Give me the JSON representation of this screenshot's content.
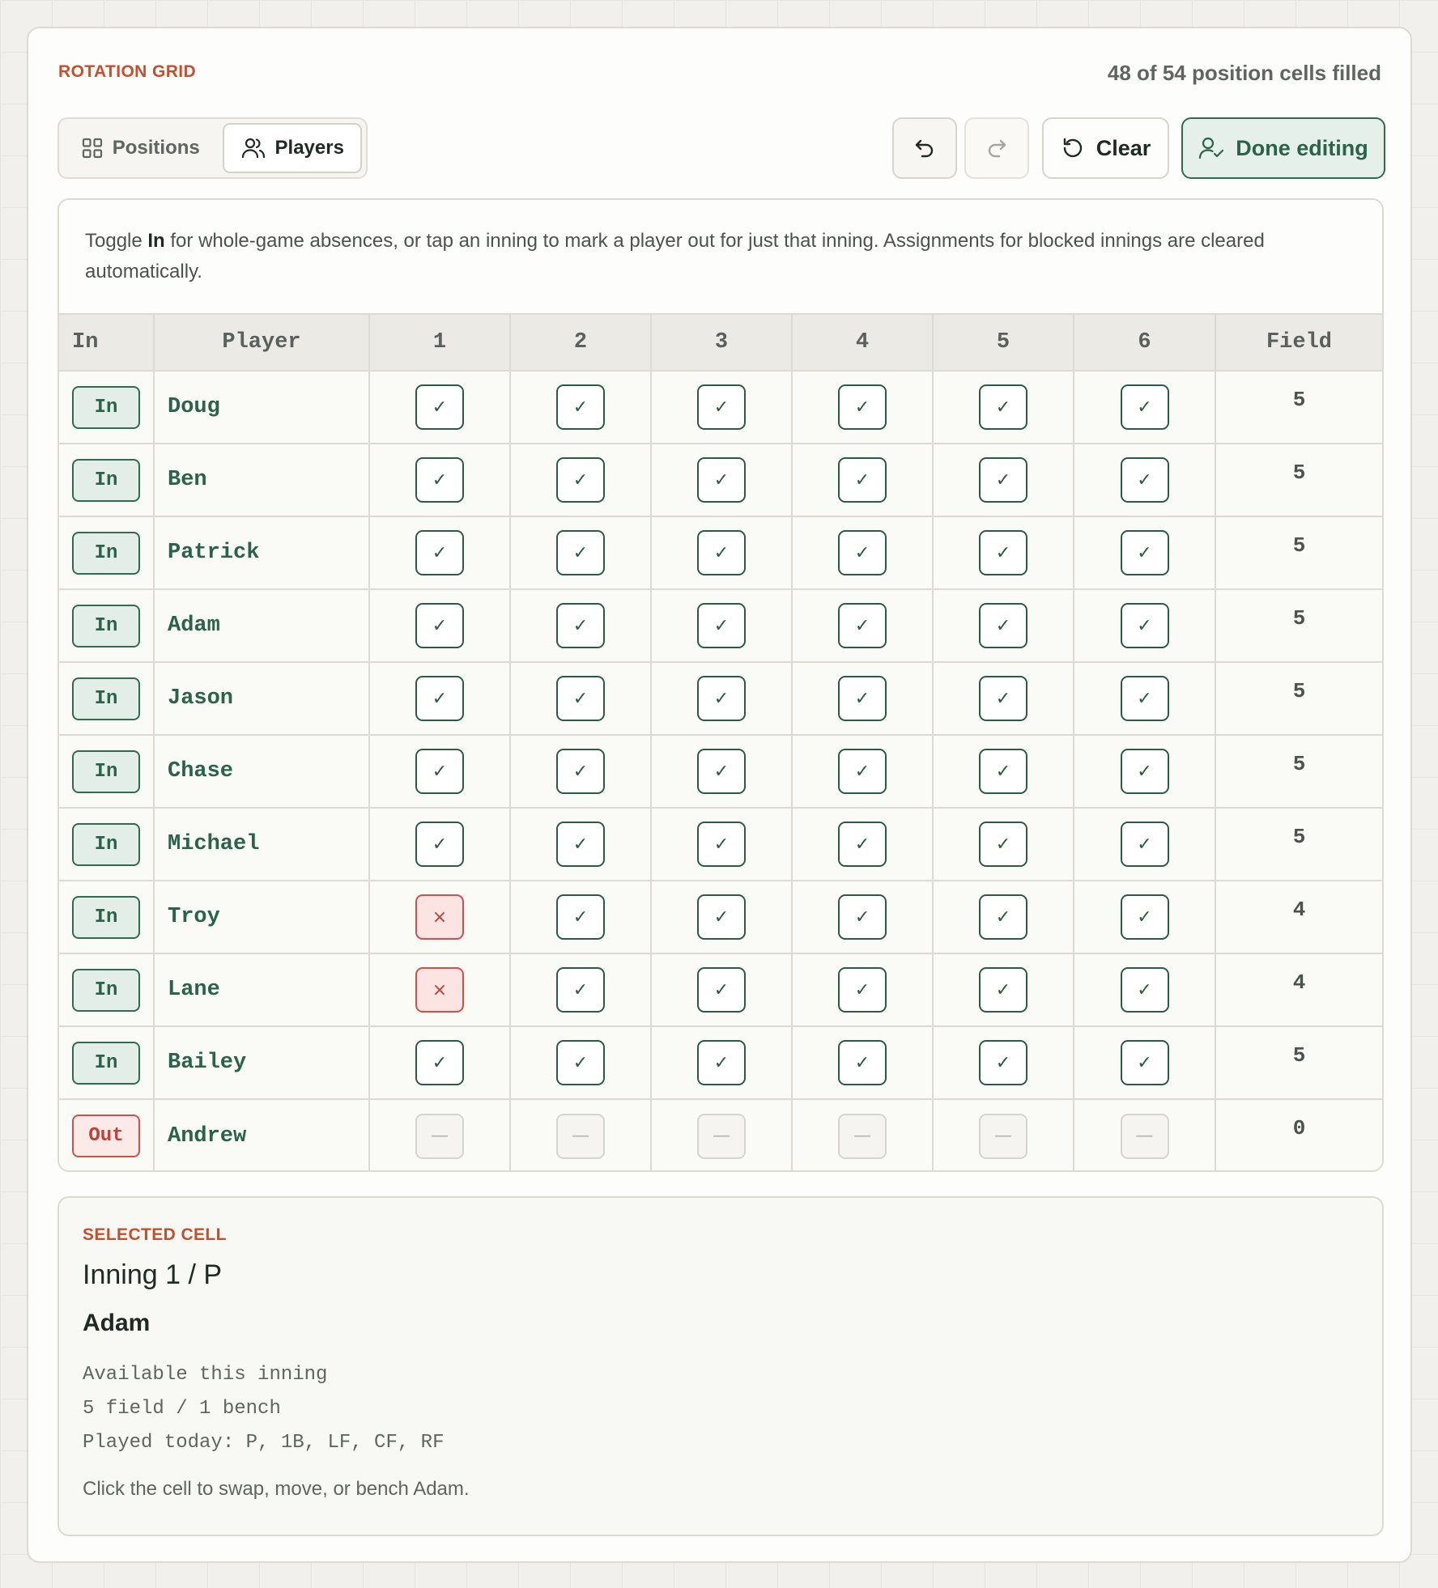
{
  "header": {
    "eyebrow": "ROTATION GRID",
    "fill_status": "48 of 54 position cells filled"
  },
  "view_toggle": {
    "positions_label": "Positions",
    "players_label": "Players",
    "selected": "Players"
  },
  "toolbar": {
    "clear_label": "Clear",
    "done_label": "Done editing"
  },
  "hint": {
    "pre": "Toggle ",
    "bold": "In",
    "post": " for whole-game absences, or tap an inning to mark a player out for just that inning. Assignments for blocked innings are cleared automatically."
  },
  "table": {
    "headers": [
      "In",
      "Player",
      "1",
      "2",
      "3",
      "4",
      "5",
      "6",
      "Field"
    ],
    "rows": [
      {
        "status": "In",
        "name": "Doug",
        "innings": [
          "✓",
          "✓",
          "✓",
          "✓",
          "✓",
          "✓"
        ],
        "field": "5"
      },
      {
        "status": "In",
        "name": "Ben",
        "innings": [
          "✓",
          "✓",
          "✓",
          "✓",
          "✓",
          "✓"
        ],
        "field": "5"
      },
      {
        "status": "In",
        "name": "Patrick",
        "innings": [
          "✓",
          "✓",
          "✓",
          "✓",
          "✓",
          "✓"
        ],
        "field": "5"
      },
      {
        "status": "In",
        "name": "Adam",
        "innings": [
          "✓",
          "✓",
          "✓",
          "✓",
          "✓",
          "✓"
        ],
        "field": "5"
      },
      {
        "status": "In",
        "name": "Jason",
        "innings": [
          "✓",
          "✓",
          "✓",
          "✓",
          "✓",
          "✓"
        ],
        "field": "5"
      },
      {
        "status": "In",
        "name": "Chase",
        "innings": [
          "✓",
          "✓",
          "✓",
          "✓",
          "✓",
          "✓"
        ],
        "field": "5"
      },
      {
        "status": "In",
        "name": "Michael",
        "innings": [
          "✓",
          "✓",
          "✓",
          "✓",
          "✓",
          "✓"
        ],
        "field": "5"
      },
      {
        "status": "In",
        "name": "Troy",
        "innings": [
          "×",
          "✓",
          "✓",
          "✓",
          "✓",
          "✓"
        ],
        "field": "4"
      },
      {
        "status": "In",
        "name": "Lane",
        "innings": [
          "×",
          "✓",
          "✓",
          "✓",
          "✓",
          "✓"
        ],
        "field": "4"
      },
      {
        "status": "In",
        "name": "Bailey",
        "innings": [
          "✓",
          "✓",
          "✓",
          "✓",
          "✓",
          "✓"
        ],
        "field": "5"
      },
      {
        "status": "Out",
        "name": "Andrew",
        "innings": [
          "—",
          "—",
          "—",
          "—",
          "—",
          "—"
        ],
        "field": "0"
      }
    ]
  },
  "selected": {
    "eyebrow": "SELECTED CELL",
    "title": "Inning 1 / P",
    "player": "Adam",
    "line1": "Available this inning",
    "line2": "5 field / 1 bench",
    "line3": "Played today: P, 1B, LF, CF, RF",
    "note": "Click the cell to swap, move, or bench Adam."
  },
  "colors": {
    "accent": "#c4502e",
    "green": "#2a6349",
    "red": "#c23f38",
    "background": "#f1f0ec"
  }
}
